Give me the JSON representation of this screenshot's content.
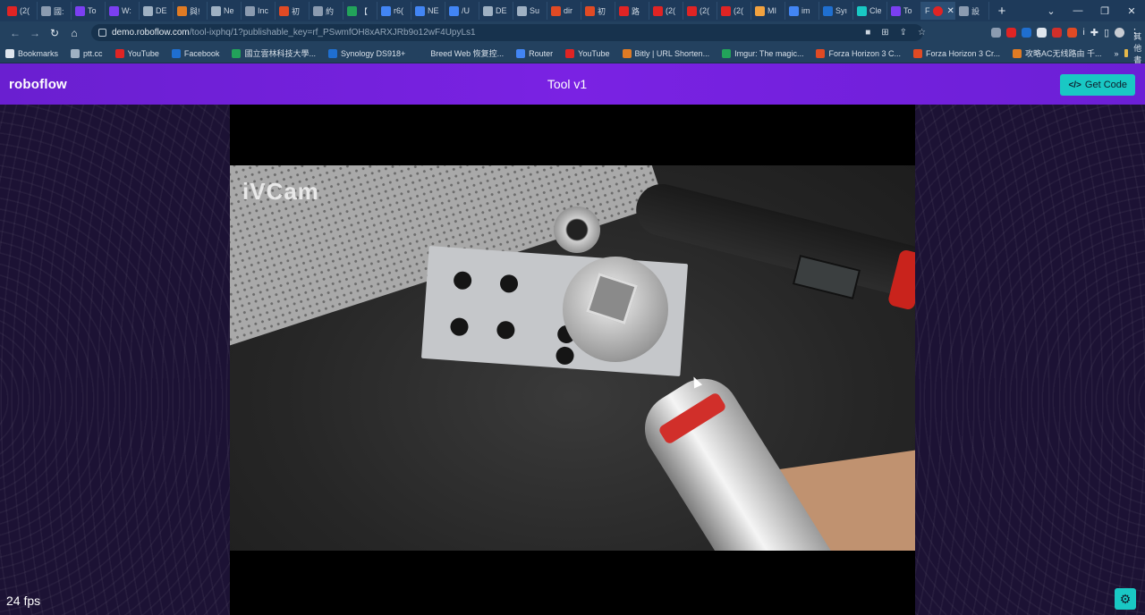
{
  "browser": {
    "tabs": [
      {
        "label": "(2(",
        "color": "#e02424"
      },
      {
        "label": "國:",
        "color": "#8b9bb0"
      },
      {
        "label": "To",
        "color": "#7b3ff2"
      },
      {
        "label": "W:",
        "color": "#7b3ff2"
      },
      {
        "label": "DE",
        "color": "#9fb1c3"
      },
      {
        "label": "與!",
        "color": "#e07b24"
      },
      {
        "label": "Ne",
        "color": "#9fb1c3"
      },
      {
        "label": "Inc",
        "color": "#8b9bb0"
      },
      {
        "label": "初",
        "color": "#e04a24"
      },
      {
        "label": "約",
        "color": "#8b9bb0"
      },
      {
        "label": "【",
        "color": "#22a35a"
      },
      {
        "label": "r6(",
        "color": "#4285f4"
      },
      {
        "label": "NE",
        "color": "#4285f4"
      },
      {
        "label": "/U",
        "color": "#4285f4"
      },
      {
        "label": "DE",
        "color": "#9fb1c3"
      },
      {
        "label": "Su",
        "color": "#9fb1c3"
      },
      {
        "label": "dir",
        "color": "#e04a24"
      },
      {
        "label": "初",
        "color": "#e04a24"
      },
      {
        "label": "路",
        "color": "#e02424"
      },
      {
        "label": "(2(",
        "color": "#e02424"
      },
      {
        "label": "(2(",
        "color": "#e02424"
      },
      {
        "label": "(2(",
        "color": "#e02424"
      },
      {
        "label": "MI",
        "color": "#f2a23f"
      },
      {
        "label": "im",
        "color": "#4285f4"
      },
      {
        "label": "Syı",
        "color": "#1f6fd0"
      },
      {
        "label": "Cle",
        "color": "#19c8c4"
      },
      {
        "label": "To",
        "color": "#7b3ff2"
      }
    ],
    "active_tab_letter": "F",
    "active_tab_close": "✕",
    "extra_tab_label": "設",
    "new_tab": "+",
    "window_controls": [
      "⌄",
      "—",
      "❐",
      "✕"
    ],
    "url_host": "demo.roboflow.com",
    "url_path": "/tool-ixphq/1?publishable_key=rf_PSwmfOH8xARXJRb9o12wF4UpyLs1",
    "bookmarks": [
      {
        "label": "Bookmarks",
        "color": "#dfe6ee"
      },
      {
        "label": "ptt.cc",
        "color": "#9fb1c3"
      },
      {
        "label": "YouTube",
        "color": "#e02424"
      },
      {
        "label": "Facebook",
        "color": "#1f6fd0"
      },
      {
        "label": "國立雲林科技大學...",
        "color": "#22a35a"
      },
      {
        "label": "Synology DS918+",
        "color": "#1f6fd0"
      },
      {
        "label": "Breed Web 恢复控...",
        "color": "#23415f"
      },
      {
        "label": "Router",
        "color": "#4285f4"
      },
      {
        "label": "YouTube",
        "color": "#e02424"
      },
      {
        "label": "Bitly | URL Shorten...",
        "color": "#e07b24"
      },
      {
        "label": "Imgur: The magic...",
        "color": "#22a35a"
      },
      {
        "label": "Forza Horizon 3 C...",
        "color": "#e04a24"
      },
      {
        "label": "Forza Horizon 3 Cr...",
        "color": "#e04a24"
      },
      {
        "label": "攻略AC无线路由 千...",
        "color": "#e07b24"
      }
    ],
    "bookmarks_more": "»",
    "other_bookmarks": "其他書籤"
  },
  "app": {
    "logo": "roboflow",
    "title": "Tool v1",
    "get_code_icon": "</>",
    "get_code_label": "Get Code",
    "watermark": "iVCam",
    "fps": "24 fps",
    "settings_icon": "⚙"
  }
}
